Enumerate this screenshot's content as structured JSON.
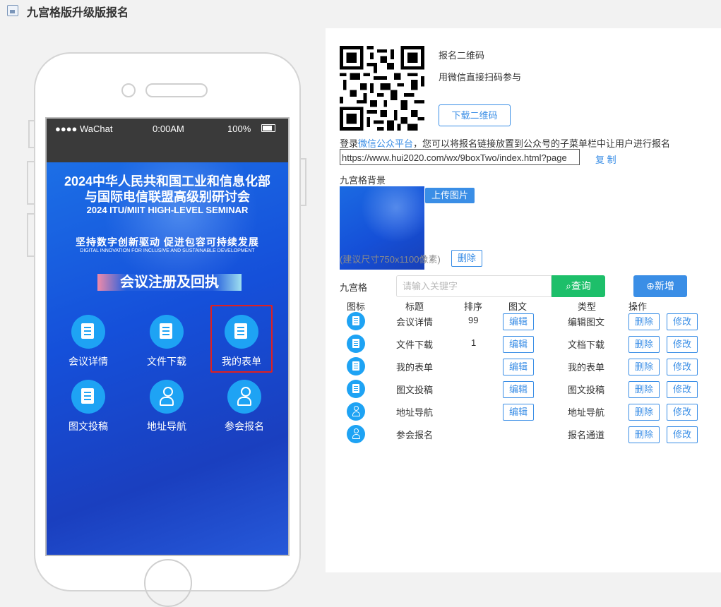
{
  "window": {
    "title": "九宫格版升级版报名"
  },
  "phone": {
    "status": {
      "carrier": "●●●● WaChat",
      "time": "0:00AM",
      "battery": "100%"
    },
    "banner": {
      "title_line1": "2024中华人民共和国工业和信息化部",
      "title_line2": "与国际电信联盟高级别研讨会",
      "title_en": "2024 ITU/MIIT HIGH-LEVEL SEMINAR",
      "slogan": "坚持数字创新驱动    促进包容可持续发展",
      "slogan_en": "DIGITAL INNOVATION FOR INCLUSIVE AND SUSTAINABLE DEVELOPMENT",
      "section_title": "会议注册及回执"
    },
    "grid": [
      {
        "label": "会议详情",
        "icon": "document-list-icon"
      },
      {
        "label": "文件下载",
        "icon": "files-icon"
      },
      {
        "label": "我的表单",
        "icon": "form-icon",
        "selected": true
      },
      {
        "label": "图文投稿",
        "icon": "article-icon"
      },
      {
        "label": "地址导航",
        "icon": "user-location-icon"
      },
      {
        "label": "参会报名",
        "icon": "user-add-icon"
      }
    ]
  },
  "qr": {
    "label": "报名二维码",
    "hint": "用微信直接扫码参与",
    "download_button": "下载二维码"
  },
  "link_section": {
    "prefix": "登录",
    "platform_link": "微信公众平台",
    "suffix": "，您可以将报名链接放置到公众号的子菜单栏中让用户进行报名",
    "url": "https://www.hui2020.com/wx/9boxTwo/index.html?page",
    "copy": "复 制"
  },
  "background": {
    "label": "九宫格背景",
    "upload_button": "上传图片",
    "size_hint": "(建议尺寸750x1100像素)",
    "delete_button": "删除"
  },
  "toolbar": {
    "label": "九宫格",
    "search_placeholder": "请输入关键字",
    "query_button": "查询",
    "add_button": "新增"
  },
  "table": {
    "headers": {
      "icon": "图标",
      "title": "标题",
      "order": "排序",
      "content": "图文",
      "type": "类型",
      "actions": "操作"
    },
    "rows": [
      {
        "title": "会议详情",
        "order": "99",
        "edit": "编辑",
        "type": "编辑图文",
        "delete": "删除",
        "modify": "修改"
      },
      {
        "title": "文件下载",
        "order": "1",
        "edit": "编辑",
        "type": "文档下载",
        "delete": "删除",
        "modify": "修改"
      },
      {
        "title": "我的表单",
        "order": "",
        "edit": "编辑",
        "type": "我的表单",
        "delete": "删除",
        "modify": "修改"
      },
      {
        "title": "图文投稿",
        "order": "",
        "edit": "编辑",
        "type": "图文投稿",
        "delete": "删除",
        "modify": "修改"
      },
      {
        "title": "地址导航",
        "order": "",
        "edit": "编辑",
        "type": "地址导航",
        "delete": "删除",
        "modify": "修改"
      },
      {
        "title": "参会报名",
        "order": "",
        "edit": "",
        "type": "报名通道",
        "delete": "删除",
        "modify": "修改"
      }
    ]
  },
  "colors": {
    "accent": "#3a8ee6",
    "query_green": "#1dbf6a",
    "icon_blue": "#1ea3f4",
    "highlight_red": "#e02020"
  }
}
